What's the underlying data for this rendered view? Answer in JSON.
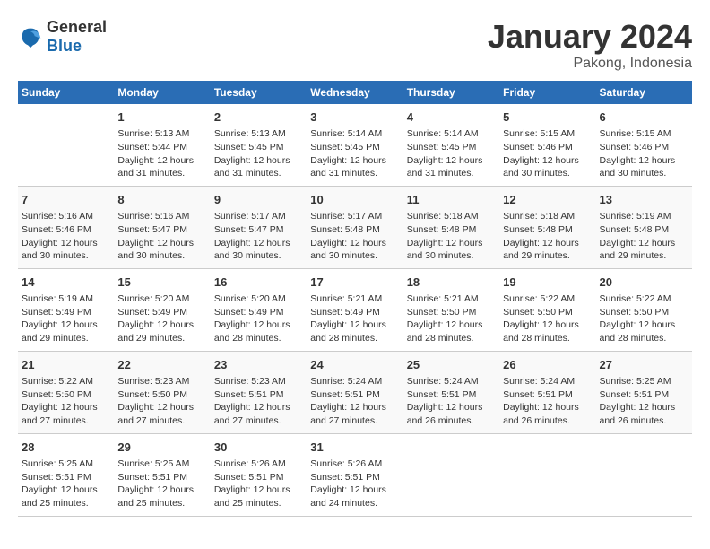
{
  "logo": {
    "general": "General",
    "blue": "Blue"
  },
  "title": "January 2024",
  "subtitle": "Pakong, Indonesia",
  "days_header": [
    "Sunday",
    "Monday",
    "Tuesday",
    "Wednesday",
    "Thursday",
    "Friday",
    "Saturday"
  ],
  "weeks": [
    [
      {
        "num": "",
        "info": ""
      },
      {
        "num": "1",
        "info": "Sunrise: 5:13 AM\nSunset: 5:44 PM\nDaylight: 12 hours\nand 31 minutes."
      },
      {
        "num": "2",
        "info": "Sunrise: 5:13 AM\nSunset: 5:45 PM\nDaylight: 12 hours\nand 31 minutes."
      },
      {
        "num": "3",
        "info": "Sunrise: 5:14 AM\nSunset: 5:45 PM\nDaylight: 12 hours\nand 31 minutes."
      },
      {
        "num": "4",
        "info": "Sunrise: 5:14 AM\nSunset: 5:45 PM\nDaylight: 12 hours\nand 31 minutes."
      },
      {
        "num": "5",
        "info": "Sunrise: 5:15 AM\nSunset: 5:46 PM\nDaylight: 12 hours\nand 30 minutes."
      },
      {
        "num": "6",
        "info": "Sunrise: 5:15 AM\nSunset: 5:46 PM\nDaylight: 12 hours\nand 30 minutes."
      }
    ],
    [
      {
        "num": "7",
        "info": "Sunrise: 5:16 AM\nSunset: 5:46 PM\nDaylight: 12 hours\nand 30 minutes."
      },
      {
        "num": "8",
        "info": "Sunrise: 5:16 AM\nSunset: 5:47 PM\nDaylight: 12 hours\nand 30 minutes."
      },
      {
        "num": "9",
        "info": "Sunrise: 5:17 AM\nSunset: 5:47 PM\nDaylight: 12 hours\nand 30 minutes."
      },
      {
        "num": "10",
        "info": "Sunrise: 5:17 AM\nSunset: 5:48 PM\nDaylight: 12 hours\nand 30 minutes."
      },
      {
        "num": "11",
        "info": "Sunrise: 5:18 AM\nSunset: 5:48 PM\nDaylight: 12 hours\nand 30 minutes."
      },
      {
        "num": "12",
        "info": "Sunrise: 5:18 AM\nSunset: 5:48 PM\nDaylight: 12 hours\nand 29 minutes."
      },
      {
        "num": "13",
        "info": "Sunrise: 5:19 AM\nSunset: 5:48 PM\nDaylight: 12 hours\nand 29 minutes."
      }
    ],
    [
      {
        "num": "14",
        "info": "Sunrise: 5:19 AM\nSunset: 5:49 PM\nDaylight: 12 hours\nand 29 minutes."
      },
      {
        "num": "15",
        "info": "Sunrise: 5:20 AM\nSunset: 5:49 PM\nDaylight: 12 hours\nand 29 minutes."
      },
      {
        "num": "16",
        "info": "Sunrise: 5:20 AM\nSunset: 5:49 PM\nDaylight: 12 hours\nand 28 minutes."
      },
      {
        "num": "17",
        "info": "Sunrise: 5:21 AM\nSunset: 5:49 PM\nDaylight: 12 hours\nand 28 minutes."
      },
      {
        "num": "18",
        "info": "Sunrise: 5:21 AM\nSunset: 5:50 PM\nDaylight: 12 hours\nand 28 minutes."
      },
      {
        "num": "19",
        "info": "Sunrise: 5:22 AM\nSunset: 5:50 PM\nDaylight: 12 hours\nand 28 minutes."
      },
      {
        "num": "20",
        "info": "Sunrise: 5:22 AM\nSunset: 5:50 PM\nDaylight: 12 hours\nand 28 minutes."
      }
    ],
    [
      {
        "num": "21",
        "info": "Sunrise: 5:22 AM\nSunset: 5:50 PM\nDaylight: 12 hours\nand 27 minutes."
      },
      {
        "num": "22",
        "info": "Sunrise: 5:23 AM\nSunset: 5:50 PM\nDaylight: 12 hours\nand 27 minutes."
      },
      {
        "num": "23",
        "info": "Sunrise: 5:23 AM\nSunset: 5:51 PM\nDaylight: 12 hours\nand 27 minutes."
      },
      {
        "num": "24",
        "info": "Sunrise: 5:24 AM\nSunset: 5:51 PM\nDaylight: 12 hours\nand 27 minutes."
      },
      {
        "num": "25",
        "info": "Sunrise: 5:24 AM\nSunset: 5:51 PM\nDaylight: 12 hours\nand 26 minutes."
      },
      {
        "num": "26",
        "info": "Sunrise: 5:24 AM\nSunset: 5:51 PM\nDaylight: 12 hours\nand 26 minutes."
      },
      {
        "num": "27",
        "info": "Sunrise: 5:25 AM\nSunset: 5:51 PM\nDaylight: 12 hours\nand 26 minutes."
      }
    ],
    [
      {
        "num": "28",
        "info": "Sunrise: 5:25 AM\nSunset: 5:51 PM\nDaylight: 12 hours\nand 25 minutes."
      },
      {
        "num": "29",
        "info": "Sunrise: 5:25 AM\nSunset: 5:51 PM\nDaylight: 12 hours\nand 25 minutes."
      },
      {
        "num": "30",
        "info": "Sunrise: 5:26 AM\nSunset: 5:51 PM\nDaylight: 12 hours\nand 25 minutes."
      },
      {
        "num": "31",
        "info": "Sunrise: 5:26 AM\nSunset: 5:51 PM\nDaylight: 12 hours\nand 24 minutes."
      },
      {
        "num": "",
        "info": ""
      },
      {
        "num": "",
        "info": ""
      },
      {
        "num": "",
        "info": ""
      }
    ]
  ]
}
